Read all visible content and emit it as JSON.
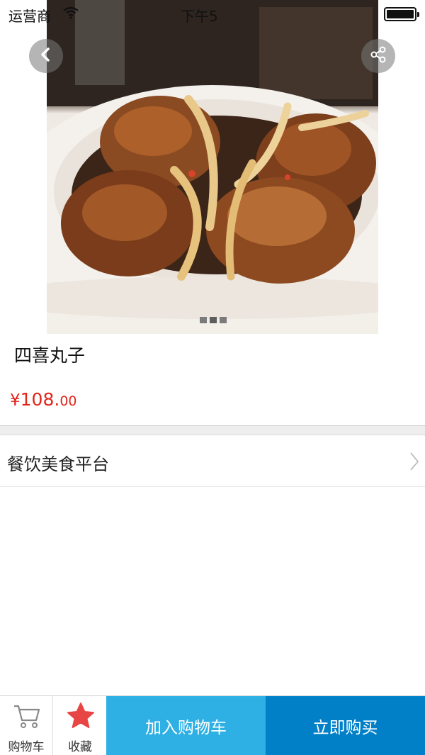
{
  "status_bar": {
    "carrier": "运营商",
    "time": "下午5"
  },
  "product": {
    "title": "四喜丸子",
    "price_symbol": "¥",
    "price_integer": "108.",
    "price_decimal": "00",
    "image_count": 3,
    "active_image_index": 1
  },
  "shop": {
    "name": "餐饮美食平台"
  },
  "bottom_bar": {
    "cart_label": "购物车",
    "favorite_label": "收藏",
    "add_to_cart_label": "加入购物车",
    "buy_now_label": "立即购买"
  },
  "colors": {
    "price": "#e1251b",
    "add_to_cart_bg": "#2eb0e4",
    "buy_now_bg": "#0180c8",
    "favorite_star": "#e84545"
  },
  "icons": {
    "back": "back-arrow-icon",
    "share": "share-icon",
    "wifi": "wifi-icon",
    "battery": "battery-icon",
    "chevron": "chevron-right-icon",
    "cart": "cart-icon",
    "favorite": "star-icon"
  }
}
